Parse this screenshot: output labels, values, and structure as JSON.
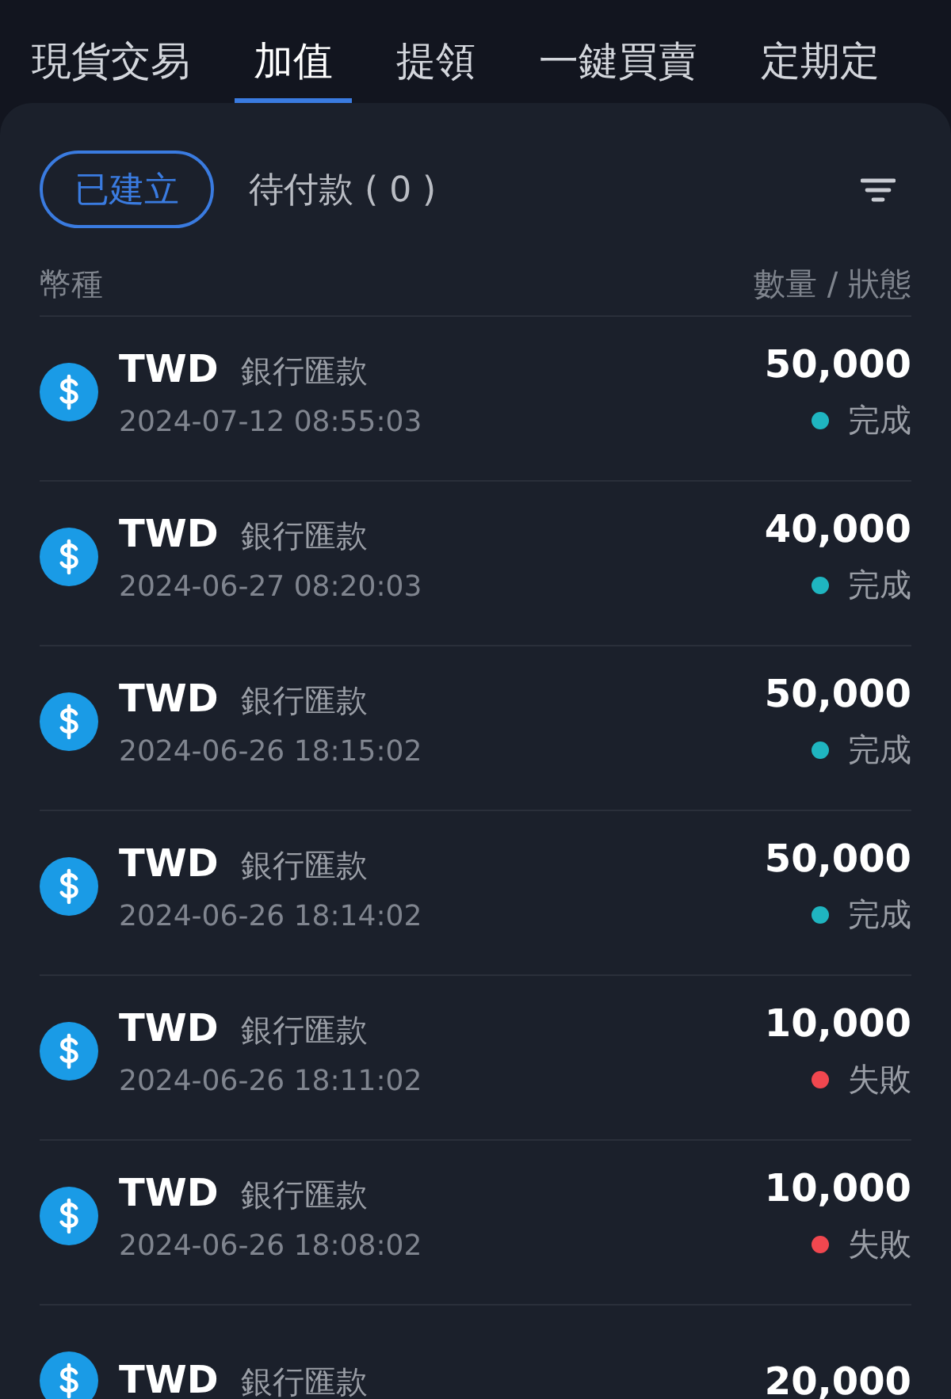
{
  "tabs": [
    {
      "label": "現貨交易",
      "selected": false
    },
    {
      "label": "加值",
      "selected": true
    },
    {
      "label": "提領",
      "selected": false
    },
    {
      "label": "一鍵買賣",
      "selected": false
    },
    {
      "label": "定期定",
      "selected": false
    }
  ],
  "filters": [
    {
      "label": "已建立",
      "selected": true
    },
    {
      "label": "待付款 ( 0 )",
      "selected": false
    }
  ],
  "header": {
    "left": "幣種",
    "right": "數量 / 狀態"
  },
  "rows": [
    {
      "currency": "TWD",
      "method": "銀行匯款",
      "time": "2024-07-12 08:55:03",
      "amount": "50,000",
      "status": "完成",
      "color": "#1fb5c0"
    },
    {
      "currency": "TWD",
      "method": "銀行匯款",
      "time": "2024-06-27 08:20:03",
      "amount": "40,000",
      "status": "完成",
      "color": "#1fb5c0"
    },
    {
      "currency": "TWD",
      "method": "銀行匯款",
      "time": "2024-06-26 18:15:02",
      "amount": "50,000",
      "status": "完成",
      "color": "#1fb5c0"
    },
    {
      "currency": "TWD",
      "method": "銀行匯款",
      "time": "2024-06-26 18:14:02",
      "amount": "50,000",
      "status": "完成",
      "color": "#1fb5c0"
    },
    {
      "currency": "TWD",
      "method": "銀行匯款",
      "time": "2024-06-26 18:11:02",
      "amount": "10,000",
      "status": "失敗",
      "color": "#f0474f"
    },
    {
      "currency": "TWD",
      "method": "銀行匯款",
      "time": "2024-06-26 18:08:02",
      "amount": "10,000",
      "status": "失敗",
      "color": "#f0474f"
    },
    {
      "currency": "TWD",
      "method": "銀行匯款",
      "amount": "20,000"
    }
  ]
}
